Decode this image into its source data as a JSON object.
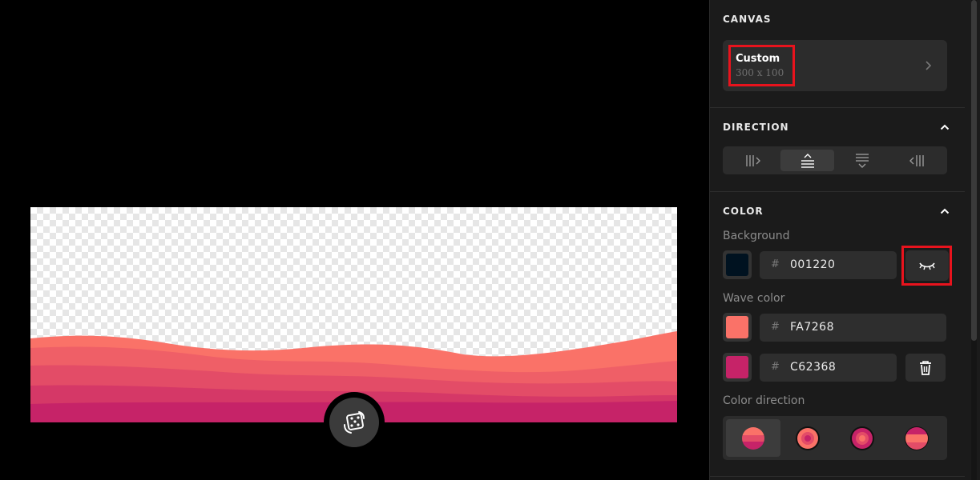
{
  "canvas": {
    "section_title": "CANVAS",
    "preset_name": "Custom",
    "preset_dims": "300 x 100"
  },
  "direction": {
    "section_title": "DIRECTION",
    "options": [
      "right",
      "up",
      "down",
      "left"
    ],
    "selected": "up"
  },
  "color": {
    "section_title": "COLOR",
    "background_label": "Background",
    "background_hex": "001220",
    "background_color": "#001220",
    "background_visibility": "hidden",
    "wave_label": "Wave color",
    "wave_colors": [
      {
        "hex": "FA7268",
        "color": "#FA7268"
      },
      {
        "hex": "C62368",
        "color": "#C62368"
      }
    ],
    "hash_symbol": "#",
    "direction_label": "Color direction",
    "direction_options": [
      "horizontal",
      "radial-center",
      "radial",
      "stripes"
    ],
    "direction_selected": "horizontal"
  },
  "waves": {
    "layer_colors": [
      "#FA7268",
      "#EF5F67",
      "#E34C67",
      "#D53867",
      "#C62368"
    ]
  },
  "icons": {
    "randomize": "dice-icon",
    "visibility": "eye-closed-icon",
    "delete": "trash-icon",
    "collapse": "chevron-up-icon",
    "open": "chevron-right-icon"
  }
}
